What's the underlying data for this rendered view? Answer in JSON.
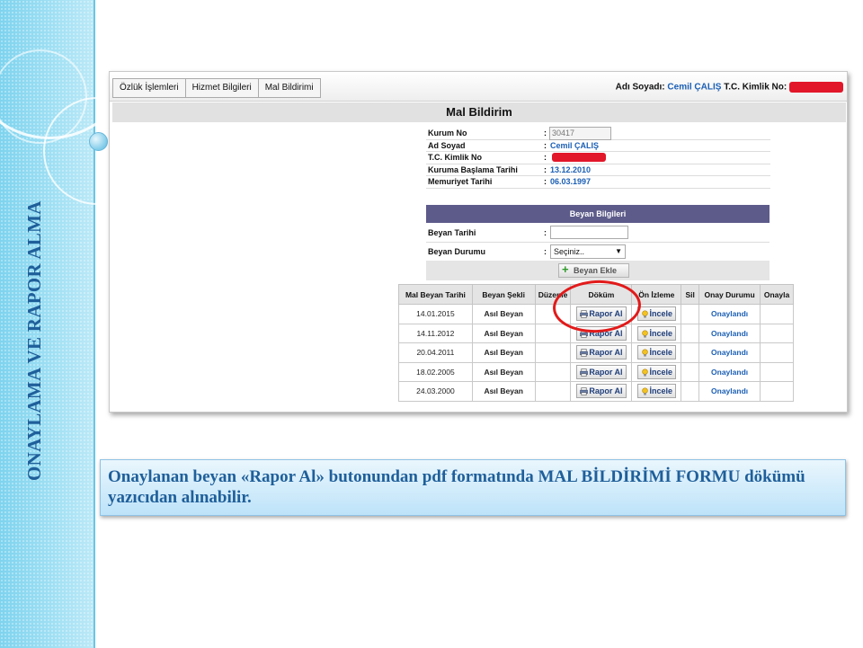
{
  "slide": {
    "side_title": "ONAYLAMA VE RAPOR ALMA",
    "caption": "Onaylanan beyan «Rapor Al» butonundan pdf formatında MAL BİLDİRİMİ FORMU dökümü yazıcıdan alınabilir."
  },
  "app": {
    "tabs": [
      "Özlük İşlemleri",
      "Hizmet Bilgileri",
      "Mal Bildirimi"
    ],
    "user": {
      "name_label": "Adı Soyadı:",
      "name_value": "Cemil ÇALIŞ",
      "tc_label": "T.C. Kimlik No:"
    },
    "form_title": "Mal Bildirim",
    "info": {
      "kurum_label": "Kurum No",
      "kurum_value": "30417",
      "ad_label": "Ad Soyad",
      "ad_value": "Cemil ÇALIŞ",
      "tc_label": "T.C. Kimlik No",
      "baslama_label": "Kuruma Başlama Tarihi",
      "baslama_value": "13.12.2010",
      "memuriyet_label": "Memuriyet Tarihi",
      "memuriyet_value": "06.03.1997",
      "colon": ":"
    },
    "beyan": {
      "header": "Beyan Bilgileri",
      "tarih_label": "Beyan Tarihi",
      "durum_label": "Beyan Durumu",
      "durum_value": "Seçiniz..",
      "add_button": "Beyan Ekle"
    },
    "table": {
      "headers": [
        "Mal Beyan Tarihi",
        "Beyan Şekli",
        "Düzenle",
        "Döküm",
        "Ön İzleme",
        "Sil",
        "Onay Durumu",
        "Onayla"
      ],
      "rapor_label": "Rapor Al",
      "incele_label": "İncele",
      "rows": [
        {
          "tarih": "14.01.2015",
          "sekli": "Asıl Beyan",
          "onay": "Onaylandı"
        },
        {
          "tarih": "14.11.2012",
          "sekli": "Asıl Beyan",
          "onay": "Onaylandı"
        },
        {
          "tarih": "20.04.2011",
          "sekli": "Asıl Beyan",
          "onay": "Onaylandı"
        },
        {
          "tarih": "18.02.2005",
          "sekli": "Asıl Beyan",
          "onay": "Onaylandı"
        },
        {
          "tarih": "24.03.2000",
          "sekli": "Asıl Beyan",
          "onay": "Onaylandı"
        }
      ]
    }
  },
  "colors": {
    "title_blue": "#1f5f9a",
    "link_blue": "#1b5fb5",
    "header_purple": "#5d5b8a",
    "highlight_red": "#e21a1a"
  }
}
